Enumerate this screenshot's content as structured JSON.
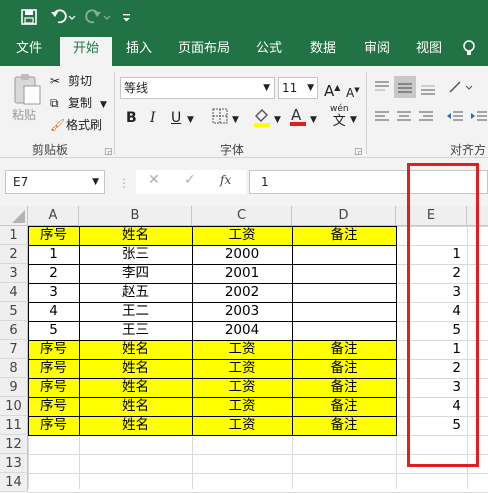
{
  "qat": {
    "save_icon": "save-icon",
    "undo_icon": "undo-icon",
    "redo_icon": "redo-icon",
    "customize_icon": "customize-icon"
  },
  "tabs": [
    "文件",
    "开始",
    "插入",
    "页面布局",
    "公式",
    "数据",
    "审阅",
    "视图"
  ],
  "ribbon": {
    "paste": "粘贴",
    "cut": "剪切",
    "copy": "复制",
    "format_painter": "格式刷",
    "clipboard_group": "剪贴板",
    "font_name": "等线",
    "font_size": "11",
    "font_group": "字体",
    "align_group": "对齐方",
    "bold": "B",
    "italic": "I",
    "underline": "U",
    "wen": "wén",
    "wen_char": "文"
  },
  "formula_bar": {
    "name_box": "E7",
    "fx": "fx",
    "value": "1"
  },
  "columns": [
    "A",
    "B",
    "C",
    "D",
    "E"
  ],
  "rows": [
    {
      "n": "1",
      "a": "序号",
      "b": "姓名",
      "c": "工资",
      "d": "备注",
      "e": "",
      "hl": true
    },
    {
      "n": "2",
      "a": "1",
      "b": "张三",
      "c": "2000",
      "d": "",
      "e": "1",
      "hl": false
    },
    {
      "n": "3",
      "a": "2",
      "b": "李四",
      "c": "2001",
      "d": "",
      "e": "2",
      "hl": false
    },
    {
      "n": "4",
      "a": "3",
      "b": "赵五",
      "c": "2002",
      "d": "",
      "e": "3",
      "hl": false
    },
    {
      "n": "5",
      "a": "4",
      "b": "王二",
      "c": "2003",
      "d": "",
      "e": "4",
      "hl": false
    },
    {
      "n": "6",
      "a": "5",
      "b": "王三",
      "c": "2004",
      "d": "",
      "e": "5",
      "hl": false
    },
    {
      "n": "7",
      "a": "序号",
      "b": "姓名",
      "c": "工资",
      "d": "备注",
      "e": "1",
      "hl": true
    },
    {
      "n": "8",
      "a": "序号",
      "b": "姓名",
      "c": "工资",
      "d": "备注",
      "e": "2",
      "hl": true
    },
    {
      "n": "9",
      "a": "序号",
      "b": "姓名",
      "c": "工资",
      "d": "备注",
      "e": "3",
      "hl": true
    },
    {
      "n": "10",
      "a": "序号",
      "b": "姓名",
      "c": "工资",
      "d": "备注",
      "e": "4",
      "hl": true
    },
    {
      "n": "11",
      "a": "序号",
      "b": "姓名",
      "c": "工资",
      "d": "备注",
      "e": "5",
      "hl": true
    },
    {
      "n": "12",
      "a": "",
      "b": "",
      "c": "",
      "d": "",
      "e": "",
      "hl": false
    },
    {
      "n": "13",
      "a": "",
      "b": "",
      "c": "",
      "d": "",
      "e": "",
      "hl": false
    },
    {
      "n": "14",
      "a": "",
      "b": "",
      "c": "",
      "d": "",
      "e": "",
      "hl": false
    }
  ],
  "colors": {
    "accent": "#217346",
    "highlight": "#ffff00",
    "annotation": "#e0201f"
  }
}
